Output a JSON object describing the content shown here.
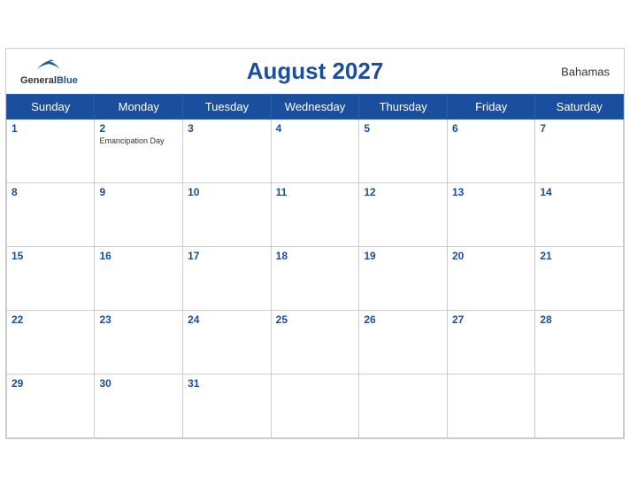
{
  "header": {
    "title": "August 2027",
    "country": "Bahamas",
    "logo": {
      "general": "General",
      "blue": "Blue"
    }
  },
  "days_of_week": [
    "Sunday",
    "Monday",
    "Tuesday",
    "Wednesday",
    "Thursday",
    "Friday",
    "Saturday"
  ],
  "weeks": [
    [
      {
        "day": 1,
        "holiday": ""
      },
      {
        "day": 2,
        "holiday": "Emancipation Day"
      },
      {
        "day": 3,
        "holiday": ""
      },
      {
        "day": 4,
        "holiday": ""
      },
      {
        "day": 5,
        "holiday": ""
      },
      {
        "day": 6,
        "holiday": ""
      },
      {
        "day": 7,
        "holiday": ""
      }
    ],
    [
      {
        "day": 8,
        "holiday": ""
      },
      {
        "day": 9,
        "holiday": ""
      },
      {
        "day": 10,
        "holiday": ""
      },
      {
        "day": 11,
        "holiday": ""
      },
      {
        "day": 12,
        "holiday": ""
      },
      {
        "day": 13,
        "holiday": ""
      },
      {
        "day": 14,
        "holiday": ""
      }
    ],
    [
      {
        "day": 15,
        "holiday": ""
      },
      {
        "day": 16,
        "holiday": ""
      },
      {
        "day": 17,
        "holiday": ""
      },
      {
        "day": 18,
        "holiday": ""
      },
      {
        "day": 19,
        "holiday": ""
      },
      {
        "day": 20,
        "holiday": ""
      },
      {
        "day": 21,
        "holiday": ""
      }
    ],
    [
      {
        "day": 22,
        "holiday": ""
      },
      {
        "day": 23,
        "holiday": ""
      },
      {
        "day": 24,
        "holiday": ""
      },
      {
        "day": 25,
        "holiday": ""
      },
      {
        "day": 26,
        "holiday": ""
      },
      {
        "day": 27,
        "holiday": ""
      },
      {
        "day": 28,
        "holiday": ""
      }
    ],
    [
      {
        "day": 29,
        "holiday": ""
      },
      {
        "day": 30,
        "holiday": ""
      },
      {
        "day": 31,
        "holiday": ""
      },
      {
        "day": null,
        "holiday": ""
      },
      {
        "day": null,
        "holiday": ""
      },
      {
        "day": null,
        "holiday": ""
      },
      {
        "day": null,
        "holiday": ""
      }
    ]
  ],
  "colors": {
    "header_bg": "#1a4fa0",
    "header_text": "#ffffff",
    "day_number": "#1a4fa0",
    "title": "#1a4fa0"
  }
}
